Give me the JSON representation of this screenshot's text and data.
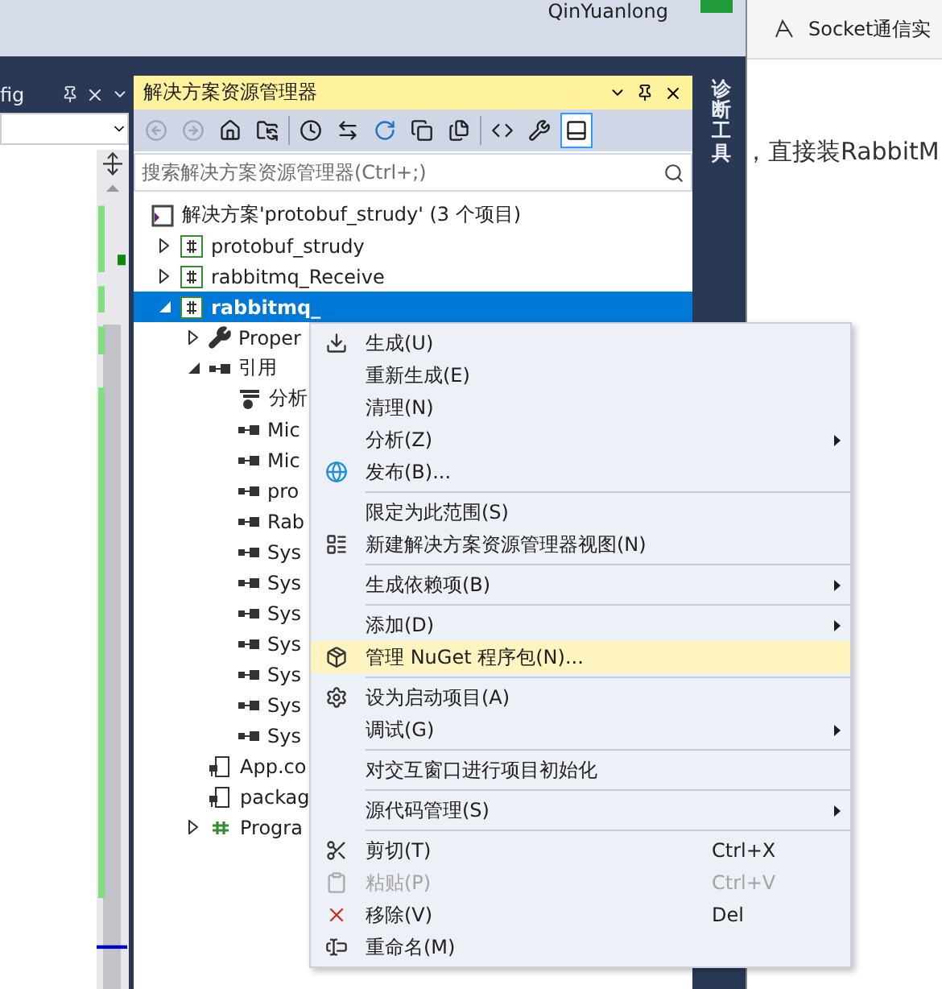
{
  "user": {
    "name": "QinYuanlong"
  },
  "doc_panel": {
    "tab": "fig"
  },
  "explorer": {
    "title": "解决方案资源管理器",
    "toolbar": [
      {
        "pressed": false,
        "disabled": true
      },
      {
        "pressed": false,
        "disabled": true
      },
      {
        "pressed": false,
        "disabled": false
      },
      {
        "pressed": false,
        "disabled": false
      },
      {
        "pressed": false,
        "disabled": false
      },
      {
        "pressed": false,
        "disabled": false
      },
      {
        "pressed": false,
        "disabled": false
      },
      {
        "pressed": false,
        "disabled": false
      },
      {
        "pressed": false,
        "disabled": false
      },
      {
        "pressed": false,
        "disabled": false
      },
      {
        "pressed": false,
        "disabled": false
      },
      {
        "pressed": true,
        "disabled": false
      }
    ],
    "search": {
      "placeholder": "搜索解决方案资源管理器(Ctrl+;)"
    },
    "tree": [
      {
        "label": "解决方案'protobuf_strudy' (3 个项目)",
        "kind": "solution",
        "selected": false
      },
      {
        "label": "protobuf_strudy",
        "kind": "project",
        "expanded": false,
        "selected": false
      },
      {
        "label": "rabbitmq_Receive",
        "kind": "project",
        "expanded": false,
        "selected": false
      },
      {
        "label": "rabbitmq_",
        "kind": "project",
        "expanded": true,
        "selected": true,
        "children": [
          {
            "label": "Proper",
            "kind": "properties",
            "expanded": false,
            "selected": false
          },
          {
            "label": "引用",
            "kind": "references",
            "expanded": true,
            "selected": false,
            "children": [
              {
                "label": "分析",
                "kind": "analyzer",
                "selected": false
              },
              {
                "label": "Mic",
                "kind": "reference",
                "selected": false
              },
              {
                "label": "Mic",
                "kind": "reference",
                "selected": false
              },
              {
                "label": "pro",
                "kind": "reference",
                "selected": false
              },
              {
                "label": "Rab",
                "kind": "reference",
                "selected": false
              },
              {
                "label": "Sys",
                "kind": "reference",
                "selected": false
              },
              {
                "label": "Sys",
                "kind": "reference",
                "selected": false
              },
              {
                "label": "Sys",
                "kind": "reference",
                "selected": false
              },
              {
                "label": "Sys",
                "kind": "reference",
                "selected": false
              },
              {
                "label": "Sys",
                "kind": "reference",
                "selected": false
              },
              {
                "label": "Sys",
                "kind": "reference",
                "selected": false
              },
              {
                "label": "Sys",
                "kind": "reference",
                "selected": false
              }
            ]
          },
          {
            "label": "App.co",
            "kind": "config",
            "selected": false
          },
          {
            "label": "packag",
            "kind": "config",
            "selected": false
          },
          {
            "label": "Progra",
            "kind": "csfile",
            "expanded": false,
            "selected": false
          }
        ]
      }
    ]
  },
  "side_tab": {
    "label": "诊断工具"
  },
  "context_menu": {
    "items": [
      {
        "kind": "item",
        "label": "生成(U)",
        "submenu": false,
        "selected": false,
        "disabled": false
      },
      {
        "kind": "item",
        "label": "重新生成(E)",
        "submenu": false,
        "selected": false,
        "disabled": false
      },
      {
        "kind": "item",
        "label": "清理(N)",
        "submenu": false,
        "selected": false,
        "disabled": false
      },
      {
        "kind": "item",
        "label": "分析(Z)",
        "submenu": true,
        "selected": false,
        "disabled": false
      },
      {
        "kind": "item",
        "label": "发布(B)...",
        "submenu": false,
        "selected": false,
        "disabled": false
      },
      {
        "kind": "separator"
      },
      {
        "kind": "item",
        "label": "限定为此范围(S)",
        "submenu": false,
        "selected": false,
        "disabled": false
      },
      {
        "kind": "item",
        "label": "新建解决方案资源管理器视图(N)",
        "submenu": false,
        "selected": false,
        "disabled": false
      },
      {
        "kind": "separator"
      },
      {
        "kind": "item",
        "label": "生成依赖项(B)",
        "submenu": true,
        "selected": false,
        "disabled": false
      },
      {
        "kind": "separator"
      },
      {
        "kind": "item",
        "label": "添加(D)",
        "submenu": true,
        "selected": false,
        "disabled": false
      },
      {
        "kind": "item",
        "label": "管理 NuGet 程序包(N)...",
        "submenu": false,
        "selected": true,
        "disabled": false
      },
      {
        "kind": "separator"
      },
      {
        "kind": "item",
        "label": "设为启动项目(A)",
        "submenu": false,
        "selected": false,
        "disabled": false
      },
      {
        "kind": "item",
        "label": "调试(G)",
        "submenu": true,
        "selected": false,
        "disabled": false
      },
      {
        "kind": "separator"
      },
      {
        "kind": "item",
        "label": "对交互窗口进行项目初始化",
        "submenu": false,
        "selected": false,
        "disabled": false
      },
      {
        "kind": "separator"
      },
      {
        "kind": "item",
        "label": "源代码管理(S)",
        "submenu": true,
        "selected": false,
        "disabled": false
      },
      {
        "kind": "separator"
      },
      {
        "kind": "item",
        "label": "剪切(T)",
        "shortcut": "Ctrl+X",
        "submenu": false,
        "selected": false,
        "disabled": false
      },
      {
        "kind": "item",
        "label": "粘贴(P)",
        "shortcut": "Ctrl+V",
        "submenu": false,
        "selected": false,
        "disabled": true
      },
      {
        "kind": "item",
        "label": "移除(V)",
        "shortcut": "Del",
        "submenu": false,
        "selected": false,
        "disabled": false
      },
      {
        "kind": "item",
        "label": "重命名(M)",
        "submenu": false,
        "selected": false,
        "disabled": false
      }
    ]
  },
  "browser": {
    "tab": "Socket通信实",
    "body_text": "，直接装RabbitM"
  }
}
